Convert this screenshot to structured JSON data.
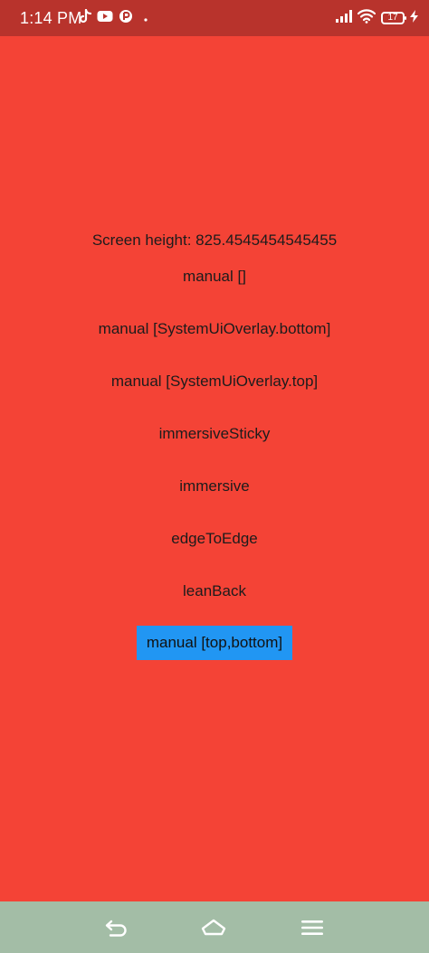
{
  "status_bar": {
    "time": "1:14 PM",
    "battery_level": "17",
    "left_icons": [
      "tiktok-icon",
      "youtube-icon",
      "app-icon",
      "dot-icon"
    ],
    "right_icons": [
      "signal-icon",
      "wifi-icon",
      "battery-icon",
      "charging-icon"
    ]
  },
  "main": {
    "screen_height_text": "Screen height: 825.4545454545455",
    "buttons": [
      {
        "label": "manual []",
        "active": false
      },
      {
        "label": "manual [SystemUiOverlay.bottom]",
        "active": false
      },
      {
        "label": "manual [SystemUiOverlay.top]",
        "active": false
      },
      {
        "label": "immersiveSticky",
        "active": false
      },
      {
        "label": "immersive",
        "active": false
      },
      {
        "label": "edgeToEdge",
        "active": false
      },
      {
        "label": "leanBack",
        "active": false
      },
      {
        "label": "manual [top,bottom]",
        "active": true
      }
    ]
  },
  "nav_bar": {
    "icons": [
      "back-icon",
      "home-icon",
      "menu-icon"
    ]
  },
  "colors": {
    "background": "#f44336",
    "status_bar": "#b8332c",
    "active_button": "#2196f3",
    "nav_bar": "#a3bda6"
  }
}
